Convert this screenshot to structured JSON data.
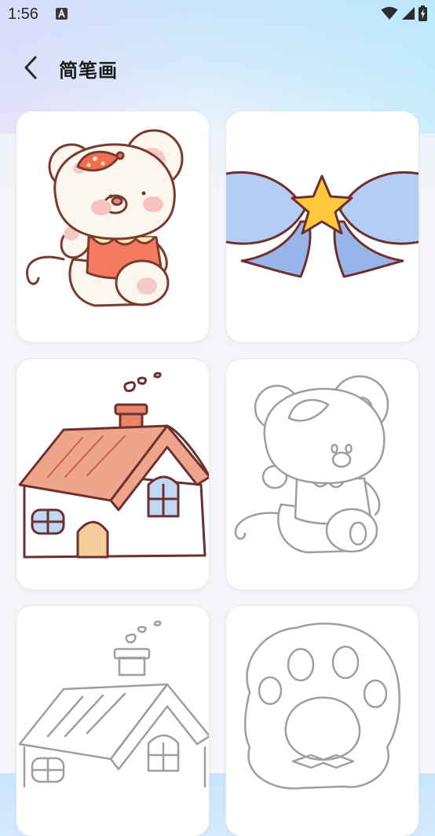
{
  "status_bar": {
    "time": "1:56",
    "notification_icon": "text-a-icon",
    "wifi_icon": "wifi-icon",
    "signal_icon": "signal-icon",
    "battery_icon": "battery-charging-icon"
  },
  "header": {
    "back_icon": "chevron-left-icon",
    "title": "简笔画"
  },
  "gallery": {
    "items": [
      {
        "name": "mouse-colored",
        "colored": true
      },
      {
        "name": "bow-with-star",
        "colored": true
      },
      {
        "name": "house-colored",
        "colored": true
      },
      {
        "name": "mouse-outline",
        "colored": false
      },
      {
        "name": "house-outline",
        "colored": false
      },
      {
        "name": "paw-outline",
        "colored": false
      }
    ]
  },
  "colors": {
    "outline": "#7a3b2e",
    "line_gray": "#9e9e9e",
    "bow_blue": "#a9c6f2",
    "star_yellow": "#ffc83d",
    "roof_pink": "#eea58c"
  }
}
